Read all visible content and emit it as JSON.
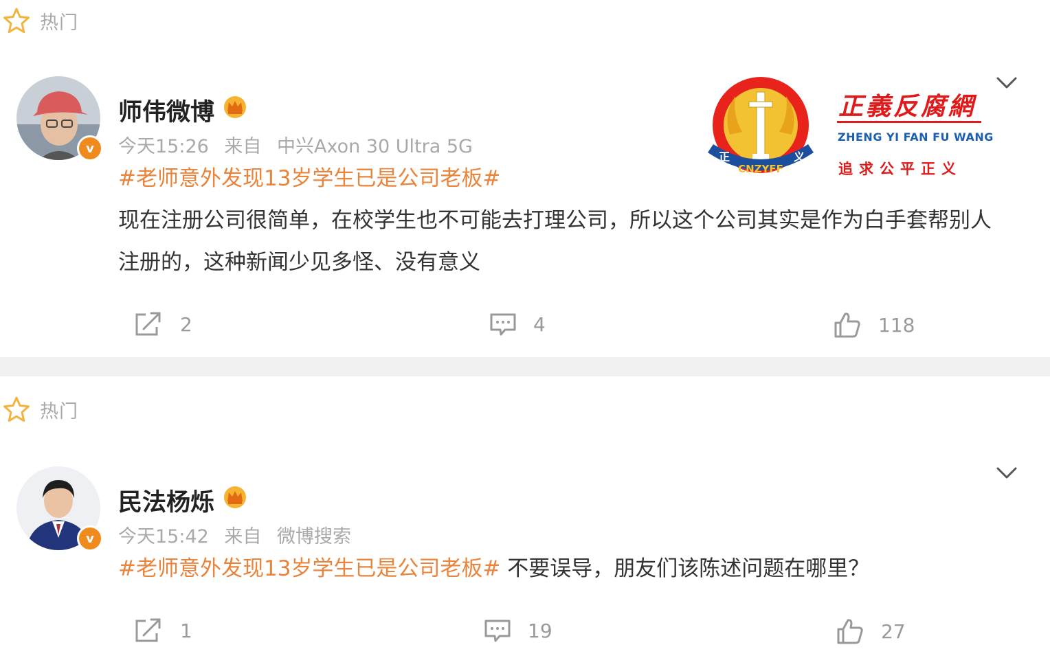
{
  "posts": [
    {
      "hot_label": "热门",
      "author": "师伟微博",
      "time": "今天15:26",
      "source_prefix": "来自",
      "source": "中兴Axon 30 Ultra 5G",
      "hashtag": "#老师意外发现13岁学生已是公司老板#",
      "text": "现在注册公司很简单，在校学生也不可能去打理公司，所以这个公司其实是作为白手套帮别人注册的，这种新闻少见多怪、没有意义",
      "reposts": "2",
      "comments": "4",
      "likes": "118"
    },
    {
      "hot_label": "热门",
      "author": "民法杨烁",
      "time": "今天15:42",
      "source_prefix": "来自",
      "source": "微博搜索",
      "hashtag": "#老师意外发现13岁学生已是公司老板#",
      "text": " 不要误导，朋友们该陈述问题在哪里？",
      "reposts": "1",
      "comments": "19",
      "likes": "27"
    }
  ],
  "verify_mark": "v",
  "watermark": {
    "name": "正義反腐網",
    "pinyin": "ZHENG YI FAN FU WANG",
    "slogan": "追求公平正义",
    "emblem_text": "CNZYFF",
    "emblem_side_left": "正",
    "emblem_side_right": "义"
  },
  "colors": {
    "hashtag": "#e8843b",
    "meta": "#a9a9a9",
    "verify_badge": "#f08a1d",
    "separator": "#f0f0f0",
    "watermark_red": "#e01a1a",
    "watermark_blue": "#1a5fb0"
  }
}
